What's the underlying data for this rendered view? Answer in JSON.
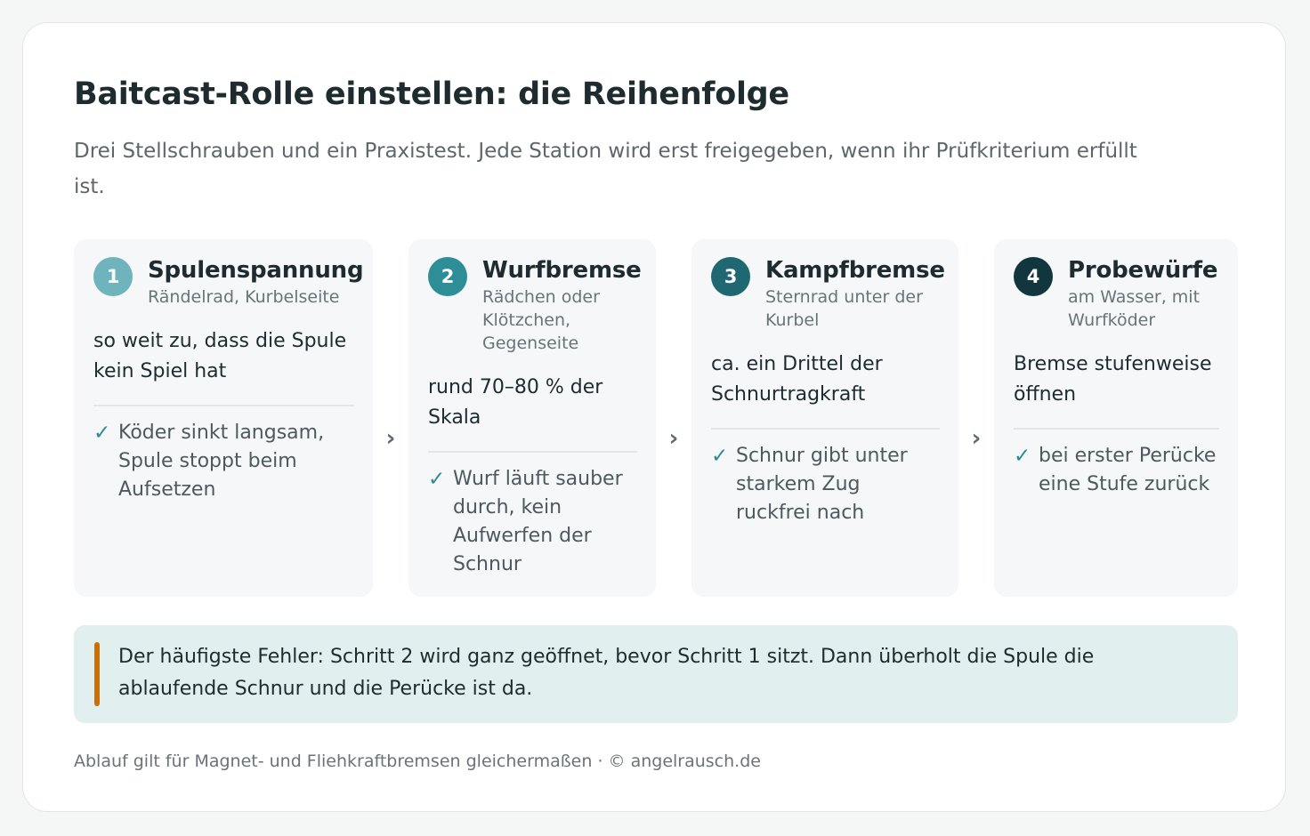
{
  "title": "Baitcast-Rolle einstellen: die Reihenfolge",
  "subtitle": "Drei Stellschrauben und ein Praxistest. Jede Station wird erst freigegeben, wenn ihr Prüfkriterium erfüllt ist.",
  "steps": [
    {
      "number": "1",
      "title": "Spulenspannung",
      "subtitle": "Rändelrad, Kurbelseite",
      "target": "so weit zu, dass die Spule kein Spiel hat",
      "check": "Köder sinkt langsam, Spule stoppt beim Aufsetzen",
      "color": "#6fb3bd"
    },
    {
      "number": "2",
      "title": "Wurfbremse",
      "subtitle": "Rädchen oder Klötzchen, Gegenseite",
      "target": "rund 70–80 % der Skala",
      "check": "Wurf läuft sauber durch, kein Aufwerfen der Schnur",
      "color": "#2d8e98"
    },
    {
      "number": "3",
      "title": "Kampfbremse",
      "subtitle": "Sternrad unter der Kurbel",
      "target": "ca. ein Drittel der Schnurtragkraft",
      "check": "Schnur gibt unter starkem Zug ruckfrei nach",
      "color": "#1f6771"
    },
    {
      "number": "4",
      "title": "Probewürfe",
      "subtitle": "am Wasser, mit Wurfköder",
      "target": "Bremse stufenweise öffnen",
      "check": "bei erster Perücke eine Stufe zurück",
      "color": "#12363d"
    }
  ],
  "arrow_glyph": "›",
  "check_glyph": "✓",
  "callout": {
    "text": "Der häufigste Fehler: Schritt 2 wird ganz geöffnet, bevor Schritt 1 sitzt. Dann überholt die Spule die ablaufende Schnur und die Perücke ist da.",
    "accent": "#c5710e"
  },
  "footer": "Ablauf gilt für Magnet- und Fliehkraftbremsen gleichermaßen · © angelrausch.de",
  "colors": {
    "check": "#2e8a92",
    "callout_bg": "#e1efef"
  }
}
